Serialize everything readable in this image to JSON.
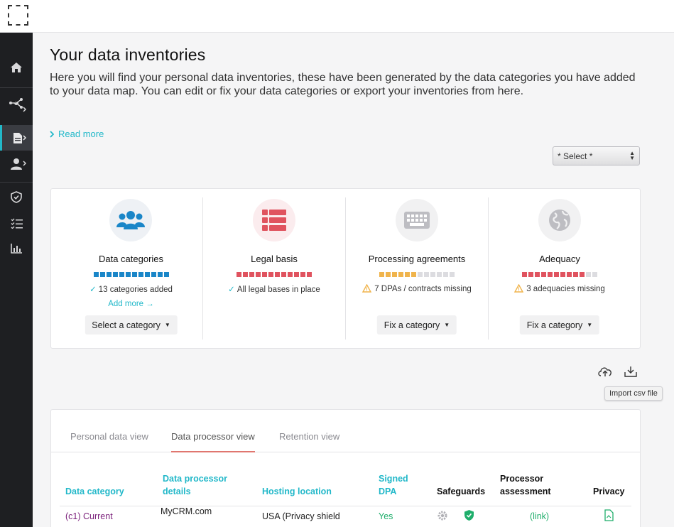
{
  "page": {
    "title": "Your data inventories",
    "description": "Here you will find your personal data inventories, these have been generated by the data categories you have added to your data map.   You can edit or fix your data categories or export your inventories from here.",
    "read_more": "Read more",
    "select_placeholder": "* Select *"
  },
  "cards": [
    {
      "title": "Data categories",
      "icon": "users-icon",
      "color": "#1a86c8",
      "progress_filled": 12,
      "progress_total": 12,
      "status": "13 categories added",
      "status_type": "ok",
      "add_more": "Add more →",
      "button": "Select a category"
    },
    {
      "title": "Legal basis",
      "icon": "list-icon",
      "color": "#e0535f",
      "progress_filled": 12,
      "progress_total": 12,
      "status": "All legal bases in place",
      "status_type": "ok"
    },
    {
      "title": "Processing agreements",
      "icon": "keyboard-icon",
      "color": "#f0b44c",
      "progress_filled": 6,
      "progress_total": 12,
      "status": "7 DPAs / contracts missing",
      "status_type": "warn",
      "button": "Fix a category"
    },
    {
      "title": "Adequacy",
      "icon": "globe-icon",
      "color": "#e0535f",
      "progress_filled": 10,
      "progress_total": 12,
      "status": "3 adequacies missing",
      "status_type": "warn",
      "button": "Fix a category"
    }
  ],
  "toolbar": {
    "tooltip": "Import csv file"
  },
  "tabs": [
    {
      "label": "Personal data view"
    },
    {
      "label": "Data processor view"
    },
    {
      "label": "Retention view"
    }
  ],
  "table": {
    "headers": {
      "data_category": "Data category",
      "processor_details": "Data processor details",
      "hosting_location": "Hosting location",
      "signed_dpa": "Signed DPA",
      "safeguards": "Safeguards",
      "processor_assessment": "Processor assessment",
      "privacy": "Privacy"
    },
    "rows": [
      {
        "data_category": "(c1) Current",
        "processor_details": "MyCRM.com",
        "hosting_location": "USA (Privacy shield",
        "signed_dpa": "Yes",
        "processor_assessment": "(link)"
      }
    ]
  },
  "colors": {
    "accent": "#22b8c9",
    "blue": "#1a86c8",
    "red": "#e0535f",
    "amber": "#f0b44c",
    "empty_segment": "#dcdce0",
    "green": "#1fae6b",
    "purple": "#7a1f7a"
  }
}
